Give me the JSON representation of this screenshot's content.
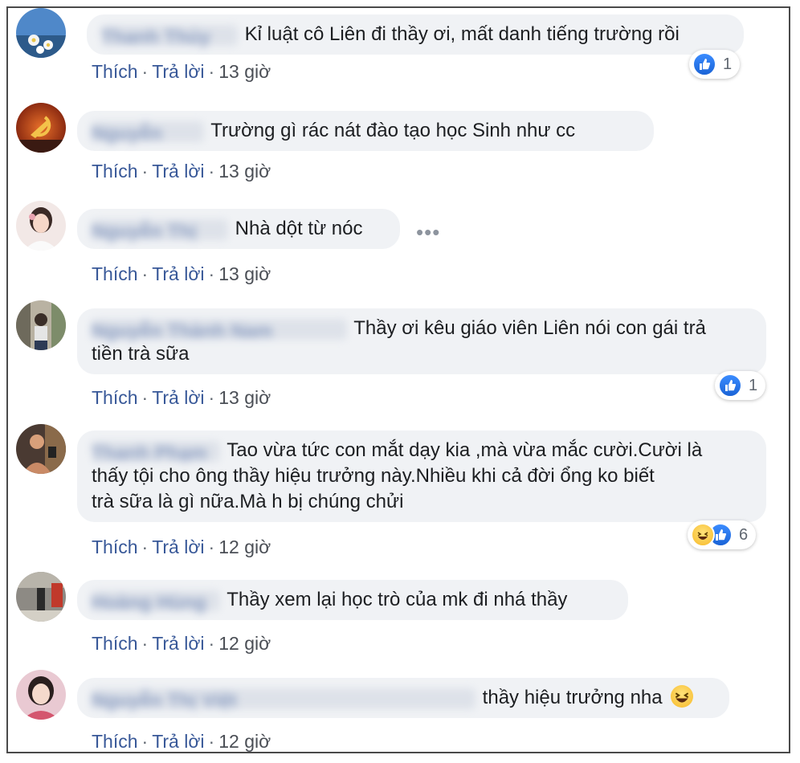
{
  "actions": {
    "like": "Thích",
    "reply": "Trả lời",
    "separator": "·"
  },
  "comments": [
    {
      "author": "Thanh Thủy",
      "text": "Kỉ luật cô Liên đi thầy ơi, mất danh tiếng trường rồi",
      "time": "13 giờ",
      "reaction_count": "1",
      "reactions": [
        "like"
      ]
    },
    {
      "author": "Nguyễn",
      "text": "Trường gì rác nát đào tạo học Sinh như cc",
      "time": "13 giờ"
    },
    {
      "author": "Nguyễn Thị",
      "text": "Nhà dột từ nóc",
      "time": "13 giờ"
    },
    {
      "author": "Nguyễn Thành Nam",
      "text_line1": "Thầy ơi kêu giáo viên Liên nói con gái trả",
      "text_line2": "tiền trà sữa",
      "time": "13 giờ",
      "reaction_count": "1",
      "reactions": [
        "like"
      ]
    },
    {
      "author": "Thanh Phạm",
      "text_line1": "Tao vừa tức con mắt dạy kia ,mà vừa mắc cười.Cười là",
      "text_line2": "thấy tội cho ông thầy hiệu trưởng này.Nhiều khi cả đời ổng ko biết",
      "text_line3": "trà sữa là gì nữa.Mà h bị chúng chửi",
      "time": "12 giờ",
      "reaction_count": "6",
      "reactions": [
        "haha",
        "like"
      ]
    },
    {
      "author": "Hoàng Hùng",
      "text": "Thầy xem lại học trò của mk đi nhá thầy",
      "time": "12 giờ"
    },
    {
      "author": "Nguyễn Thị Việt",
      "text": "thầy hiệu trưởng nha",
      "time": "12 giờ",
      "inline_emoji": "haha"
    }
  ],
  "colors": {
    "bubble": "#f0f2f5",
    "link": "#385898",
    "like_blue": "#1877f2",
    "haha_yellow": "#f7b928"
  }
}
